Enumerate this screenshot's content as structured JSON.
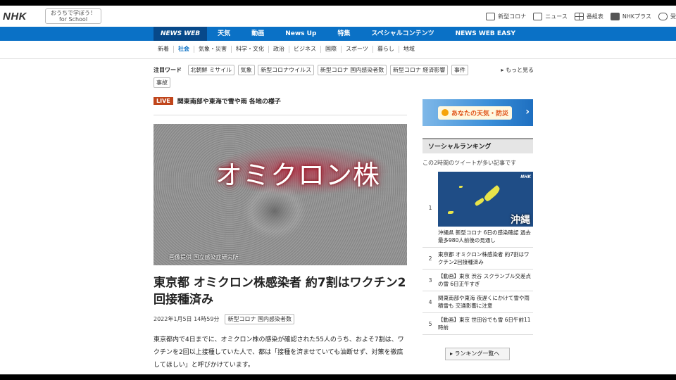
{
  "header": {
    "logo": "NHK",
    "school_line1": "おうちで学ぼう！",
    "school_line2": "for School",
    "tools": [
      {
        "label": "新型コロナ",
        "icon": "virus-icon"
      },
      {
        "label": "ニュース",
        "icon": "news-icon"
      },
      {
        "label": "番組表",
        "icon": "tv-schedule-icon"
      },
      {
        "label": "NHKプラス",
        "icon": "nhk-plus-icon"
      },
      {
        "label": "受",
        "icon": "receiver-icon"
      }
    ]
  },
  "main_nav": [
    "NEWS WEB",
    "天気",
    "動画",
    "News Up",
    "特集",
    "スペシャルコンテンツ",
    "NEWS WEB EASY"
  ],
  "sub_nav": [
    "新着",
    "社会",
    "気象・災害",
    "科学・文化",
    "政治",
    "ビジネス",
    "国際",
    "スポーツ",
    "暮らし",
    "地域"
  ],
  "keywords": {
    "label": "注目ワード",
    "tags": [
      "北朝鮮 ミサイル",
      "気象",
      "新型コロナウイルス",
      "新型コロナ 国内感染者数",
      "新型コロナ 経済影響",
      "事件",
      "事故"
    ],
    "more": "▸ もっと見る"
  },
  "live": {
    "badge": "LIVE",
    "text": "関東南部や東海で雪や雨 各地の様子"
  },
  "hero": {
    "title": "オミクロン株",
    "credit": "画像提供 国立感染症研究所"
  },
  "article": {
    "headline": "東京都 オミクロン株感染者 約7割はワクチン2回接種済み",
    "date": "2022年1月5日 14時59分",
    "tag": "新型コロナ 国内感染者数",
    "body": "東京都内で4日までに、オミクロン株の感染が確認された55人のうち、およそ7割は、ワクチンを2回以上接種していた人で、都は「接種を済ませていても油断せず、対策を徹底してほしい」と呼びかけています。"
  },
  "sidebar": {
    "weather": "あなたの天気・防災",
    "ranking_title": "ソーシャルランキング",
    "ranking_sub": "この2時間のツイートが多い記事です",
    "thumb_logo": "NHK",
    "thumb_label": "沖縄",
    "ranking": [
      {
        "num": "1",
        "text": "沖縄県 新型コロナ 6日の感染確認 過去最多980人前後の見通し"
      },
      {
        "num": "2",
        "text": "東京都 オミクロン株感染者 約7割はワクチン2回接種済み"
      },
      {
        "num": "3",
        "text": "【動画】東京 渋谷 スクランブル交差点の雪 6日正午すぎ"
      },
      {
        "num": "4",
        "text": "関東南部や東海 夜遅くにかけて雪や雨 積雪も 交通影響に注意"
      },
      {
        "num": "5",
        "text": "【動画】東京 世田谷でも雪 6日午前11時前"
      }
    ],
    "ranking_button": "▸ ランキング一覧へ"
  },
  "colors": {
    "nav_blue": "#0a71c6",
    "nav_dark": "#07498a",
    "live_red": "#c0451b"
  }
}
